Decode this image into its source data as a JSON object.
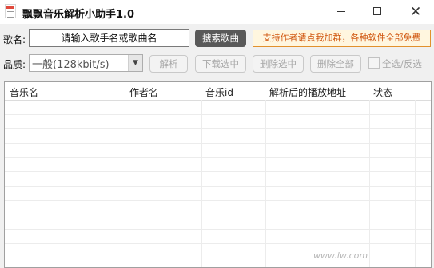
{
  "window": {
    "title": "飘飘音乐解析小助手1.0",
    "close_glyph": "✕"
  },
  "search": {
    "label": "歌名:",
    "value": "请输入歌手名或歌曲名",
    "button_label": "搜索歌曲"
  },
  "promo": {
    "text": "支持作者请点我加群，各种软件全部免费",
    "text_color": "#d0550e",
    "border_color": "#e2912c"
  },
  "quality": {
    "label": "品质:",
    "selected": "一般(128kbit/s)"
  },
  "actions": {
    "parse": "解析",
    "download_selected": "下载选中",
    "delete_selected": "删除选中",
    "delete_all": "删除全部",
    "select_all": "全选/反选"
  },
  "table": {
    "columns": [
      "音乐名",
      "作者名",
      "音乐id",
      "解析后的播放地址",
      "状态"
    ]
  },
  "watermark": "www.lw.com"
}
